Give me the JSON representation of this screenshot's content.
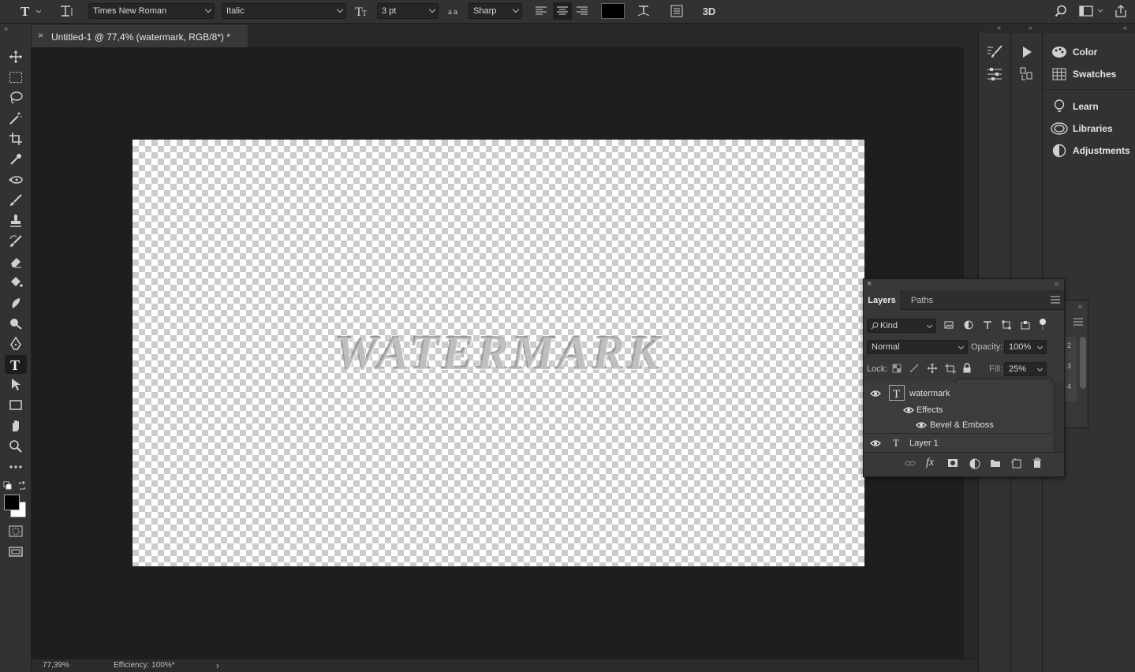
{
  "options_bar": {
    "font_family": "Times New Roman",
    "font_style": "Italic",
    "font_size": "3 pt",
    "aa_label": "a",
    "antialias": "Sharp",
    "three_d": "3D",
    "text_color": "#000000"
  },
  "document": {
    "tab_title": "Untitled-1 @ 77,4% (watermark, RGB/8*) *",
    "close": "×",
    "watermark_text": "WATERMARK"
  },
  "status": {
    "zoom": "77,39%",
    "efficiency": "Efficiency: 100%*",
    "arrow": "›"
  },
  "right_panels": {
    "items": [
      {
        "label": "Color",
        "icon": "color-palette-icon"
      },
      {
        "label": "Swatches",
        "icon": "swatches-grid-icon"
      },
      {
        "label": "Learn",
        "icon": "lightbulb-icon"
      },
      {
        "label": "Libraries",
        "icon": "libraries-icon"
      },
      {
        "label": "Adjustments",
        "icon": "adjustments-icon"
      }
    ]
  },
  "layers_panel": {
    "tabs": [
      "Layers",
      "Paths"
    ],
    "filter_kind": "Kind",
    "blend_mode": "Normal",
    "opacity_label": "Opacity:",
    "opacity_value": "100%",
    "lock_label": "Lock:",
    "fill_label": "Fill:",
    "fill_value": "25%",
    "fill_slider_level": 0.25,
    "layers": [
      {
        "name": "watermark",
        "type": "text",
        "effects_label": "Effects",
        "effect": "Bevel & Emboss"
      },
      {
        "name": "Layer 1",
        "type": "text"
      }
    ],
    "side_peek": [
      "2",
      "3",
      "4"
    ]
  },
  "colors": {
    "accent_bg": "#323232",
    "canvas_bg": "#1e1e1e",
    "foreground": "#000000",
    "background": "#ffffff"
  }
}
